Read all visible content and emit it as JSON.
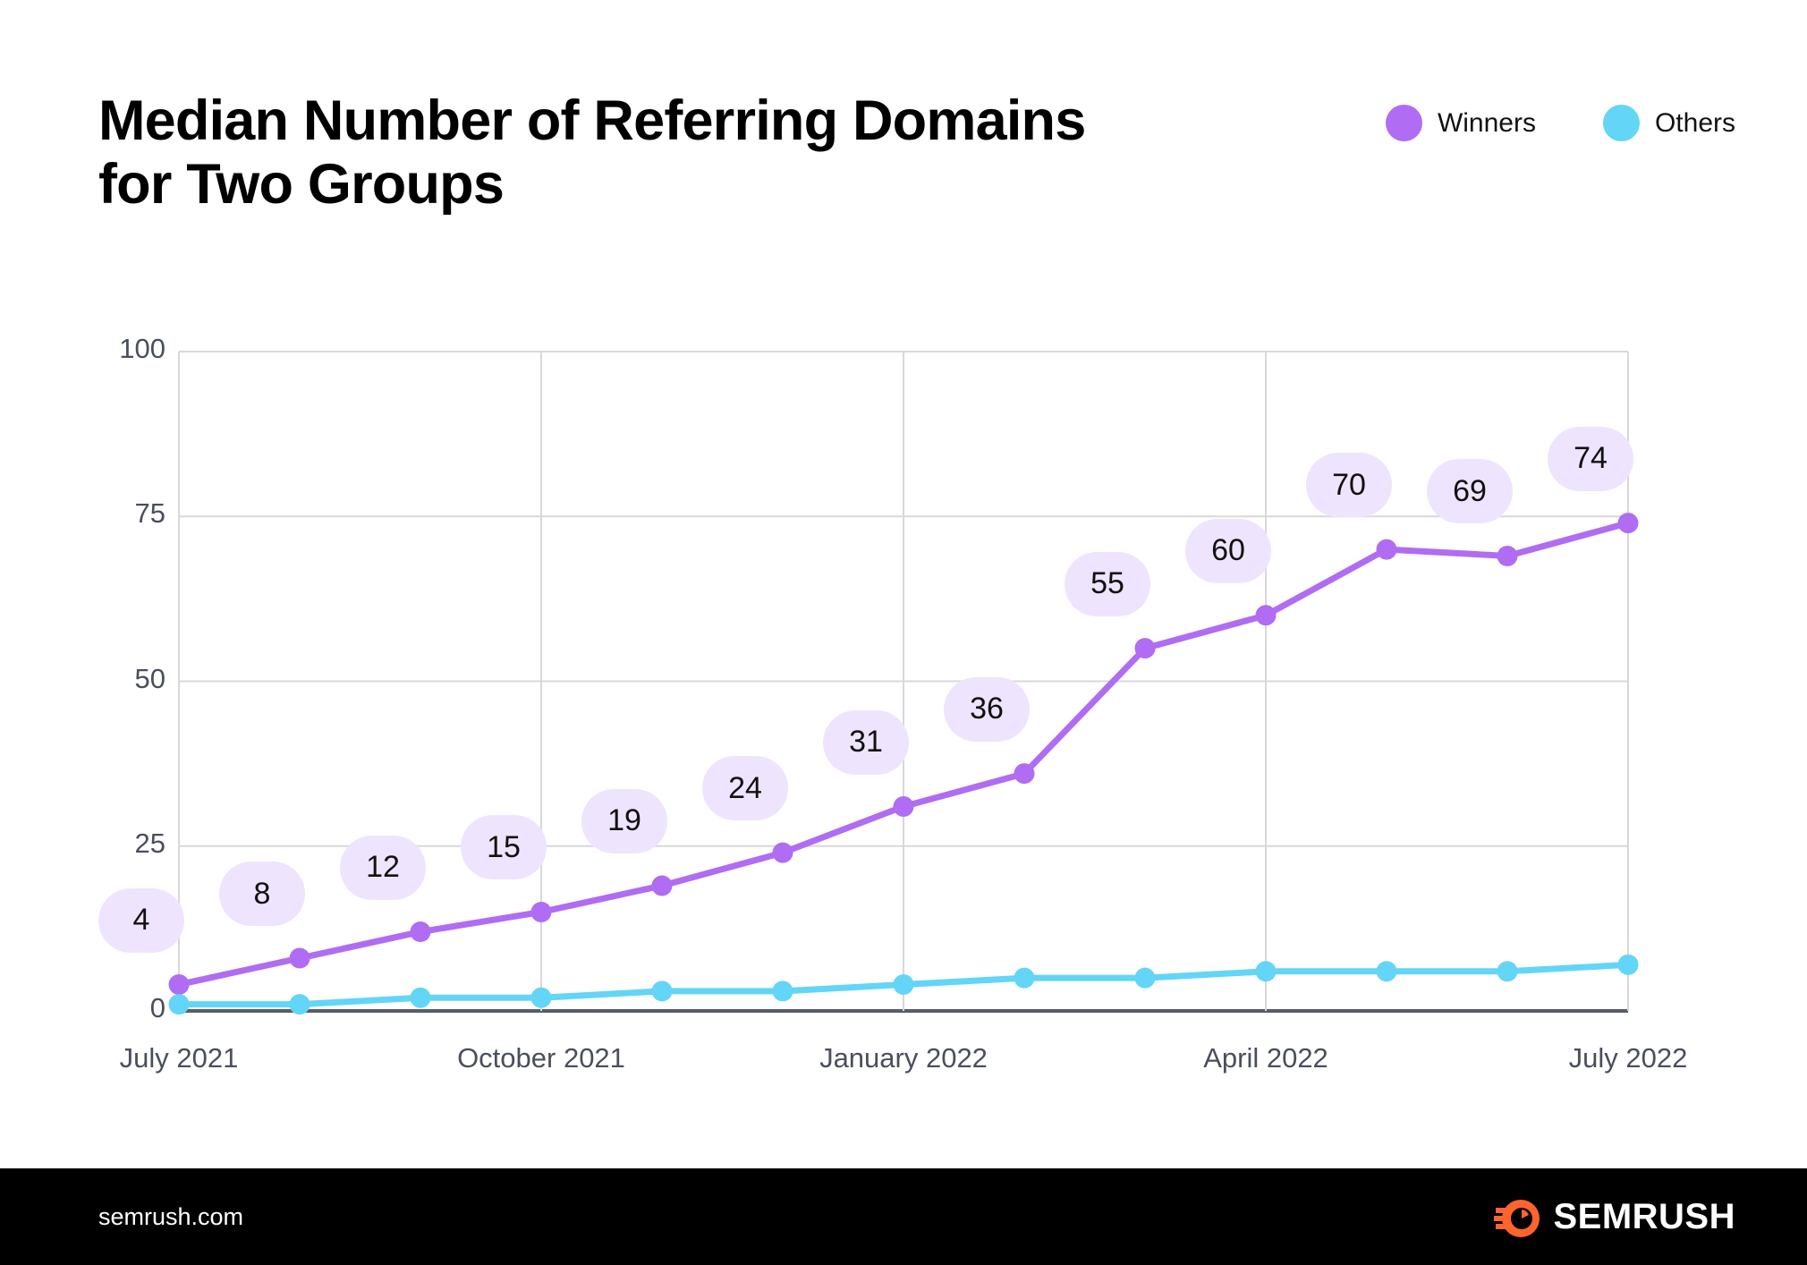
{
  "header": {
    "title": "Median Number of Referring Domains for Two Groups"
  },
  "legend": {
    "position": "top-right",
    "items": [
      {
        "label": "Winners",
        "color": "#b06cf2"
      },
      {
        "label": "Others",
        "color": "#63d5f7"
      }
    ]
  },
  "footer": {
    "url": "semrush.com",
    "logo_text": "SEMRUSH",
    "logo_icon": "semrush-comet-icon",
    "logo_color": "#ff642d",
    "background": "#000000"
  },
  "colors": {
    "winners_line": "#b06cf2",
    "others_line": "#63d5f7",
    "pill_background": "#efe4fd",
    "pill_text": "#111111",
    "gridline": "#d8d8dc",
    "axis": "#565d6e",
    "tick_text": "#4a4f5c",
    "page_background": "#ffffff"
  },
  "chart_data": {
    "type": "line",
    "title": "Median Number of Referring Domains for Two Groups",
    "xlabel": "",
    "ylabel": "",
    "ylim": [
      0,
      100
    ],
    "yticks": [
      0,
      25,
      50,
      75,
      100
    ],
    "ytick_labels": [
      "0",
      "25",
      "50",
      "75",
      "100"
    ],
    "grid": true,
    "grid_axis": "both",
    "legend_position": "top-right",
    "x": [
      "July 2021",
      "August 2021",
      "September 2021",
      "October 2021",
      "November 2021",
      "December 2021",
      "January 2022",
      "February 2022",
      "March 2022",
      "April 2022",
      "May 2022",
      "June 2022",
      "July 2022"
    ],
    "xtick_labels": [
      "July 2021",
      "October 2021",
      "January 2022",
      "April 2022",
      "July 2022"
    ],
    "xtick_indices": [
      0,
      3,
      6,
      9,
      12
    ],
    "series": [
      {
        "name": "Winners",
        "color": "#b06cf2",
        "values": [
          4,
          8,
          12,
          15,
          19,
          24,
          31,
          36,
          55,
          60,
          70,
          69,
          74
        ],
        "labels": [
          "4",
          "8",
          "12",
          "15",
          "19",
          "24",
          "31",
          "36",
          "55",
          "60",
          "70",
          "69",
          "74"
        ],
        "labeled": true
      },
      {
        "name": "Others",
        "color": "#63d5f7",
        "values": [
          1,
          1,
          2,
          2,
          3,
          3,
          4,
          5,
          5,
          6,
          6,
          6,
          7
        ],
        "labels": [],
        "labeled": false
      }
    ]
  }
}
